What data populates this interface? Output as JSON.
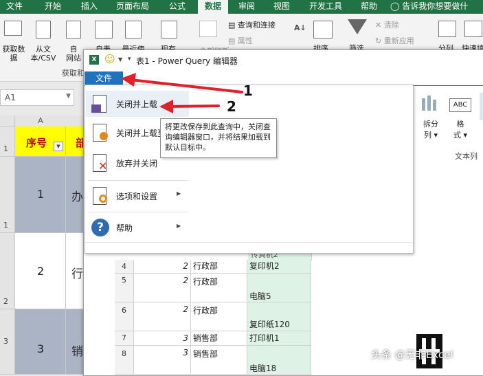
{
  "ribbon_tabs": [
    "文件",
    "开始",
    "插入",
    "页面布局",
    "公式",
    "数据",
    "审阅",
    "视图",
    "开发工具",
    "帮助"
  ],
  "active_tab": "数据",
  "tell_me": "告诉我你想要做什么...",
  "ribbon": {
    "get_data": "获取数",
    "get_data2": "据",
    "from_text": "从文",
    "from_text2": "本/CSV",
    "from_web": "自",
    "from_web2": "网站",
    "from_table": "自表",
    "recent": "最近使",
    "existing": "现有",
    "refresh_all": "全部刷新",
    "queries_connections": "查询和连接",
    "properties": "属性",
    "sort": "排序",
    "filter": "筛选",
    "clear": "清除",
    "reapply": "重新应用",
    "split_columns": "分列",
    "flash_fill": "快速填",
    "group_get": "获取和",
    "split_col_btn": "拆分",
    "split_col_btn2": "列",
    "format_btn": "格",
    "format_btn2": "式",
    "text_col_group": "文本列"
  },
  "namebox": "A1",
  "grid": {
    "col_a": "A",
    "headers": [
      "序号",
      "部"
    ],
    "rows": [
      {
        "num": "1",
        "seq": "1",
        "dept": "办"
      },
      {
        "num": "2",
        "seq": "2",
        "dept": "行"
      },
      {
        "num": "3",
        "seq": "3",
        "dept": "销"
      }
    ]
  },
  "pq": {
    "title": "表1 - Power Query 编辑器",
    "file_tab": "文件",
    "menu": [
      {
        "label": "关闭并上载",
        "icon": "close-load-icon"
      },
      {
        "label": "关闭并上载至...",
        "icon": "close-load-to-icon"
      },
      {
        "label": "放弃并关闭",
        "icon": "discard-close-icon"
      },
      {
        "label": "选项和设置",
        "icon": "options-icon"
      },
      {
        "label": "帮助",
        "icon": "help-icon"
      }
    ],
    "tooltip": "将更改保存到此查询中，关闭查询编辑器窗口，并将结果加载到默认目标中。",
    "table_rows": [
      {
        "rn": "4",
        "seq": "2",
        "dept": "行政部",
        "item": "复印机2"
      },
      {
        "rn": "5",
        "seq": "2",
        "dept": "行政部",
        "item": "电脑5"
      },
      {
        "rn": "6",
        "seq": "2",
        "dept": "行政部",
        "item": "复印纸120"
      },
      {
        "rn": "7",
        "seq": "3",
        "dept": "销售部",
        "item": "打印机1"
      },
      {
        "rn": "8",
        "seq": "3",
        "dept": "销售部",
        "item": "电脑18"
      }
    ],
    "partial_row_text": "传真机2"
  },
  "annotations": {
    "arrow1": "1",
    "arrow2": "2"
  },
  "watermark": "头条 @无非Excel",
  "colors": {
    "excel_green": "#217346",
    "pq_blue": "#1e73be",
    "arrow_red": "#e0202a",
    "header_yellow": "#ffff00"
  }
}
